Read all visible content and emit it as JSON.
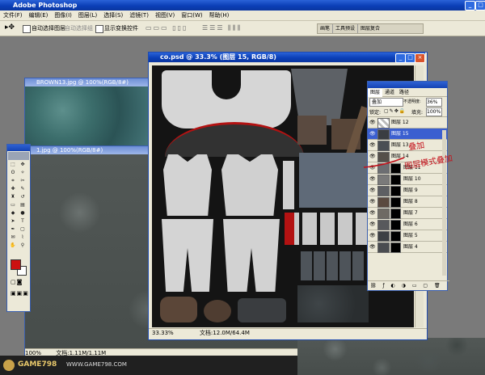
{
  "app": {
    "title": "Adobe Photoshop"
  },
  "menu": [
    "文件(F)",
    "编辑(E)",
    "图像(I)",
    "图层(L)",
    "选择(S)",
    "滤镜(T)",
    "视图(V)",
    "窗口(W)",
    "帮助(H)"
  ],
  "options": {
    "auto_select": "自动选择图层",
    "auto_align": "自动选择组",
    "show_transform": "显示变换控件"
  },
  "palette_well": {
    "tabs": [
      "画笔",
      "工具预设",
      "图层复合"
    ]
  },
  "docs": {
    "back1": {
      "title": "BROWN13.jpg @ 100%(RGB/8#)"
    },
    "back2": {
      "title": "1.jpg @ 100%(RGB/8#)",
      "zoom": "100%",
      "size": "文档:1.11M/1.11M"
    },
    "main": {
      "title": "co.psd @ 33.3% (图层 15, RGB/8)",
      "zoom": "33.33%",
      "size": "文档:12.0M/64.4M"
    }
  },
  "layers_panel": {
    "tabs": [
      "图层",
      "通道",
      "路径"
    ],
    "blend_mode": "叠加",
    "opacity_label": "不透明度:",
    "opacity_value": "36%",
    "lock_label": "锁定:",
    "fill_label": "填充:",
    "fill_value": "100%",
    "layers": [
      {
        "name": "图层 12",
        "selected": false,
        "mask": false
      },
      {
        "name": "图层 15",
        "selected": true,
        "mask": false
      },
      {
        "name": "图层 13",
        "selected": false,
        "mask": false
      },
      {
        "name": "图层 14",
        "selected": false,
        "mask": false
      },
      {
        "name": "图层 11",
        "selected": false,
        "mask": true
      },
      {
        "name": "图层 10",
        "selected": false,
        "mask": true
      },
      {
        "name": "图层 9",
        "selected": false,
        "mask": true
      },
      {
        "name": "图层 8",
        "selected": false,
        "mask": true
      },
      {
        "name": "图层 7",
        "selected": false,
        "mask": true
      },
      {
        "name": "图层 6",
        "selected": false,
        "mask": true
      },
      {
        "name": "图层 5",
        "selected": false,
        "mask": true
      },
      {
        "name": "图层 4",
        "selected": false,
        "mask": true
      }
    ]
  },
  "annotation": {
    "line1": "叠加",
    "line2": "图层模式叠加"
  },
  "watermark": {
    "logo": "GAME798",
    "url": "WWW.GAME798.COM"
  },
  "colors": {
    "foreground": "#cc1111",
    "background": "#ffffff",
    "title_blue": "#0b3fb7",
    "annotation_red": "#c4101a"
  }
}
